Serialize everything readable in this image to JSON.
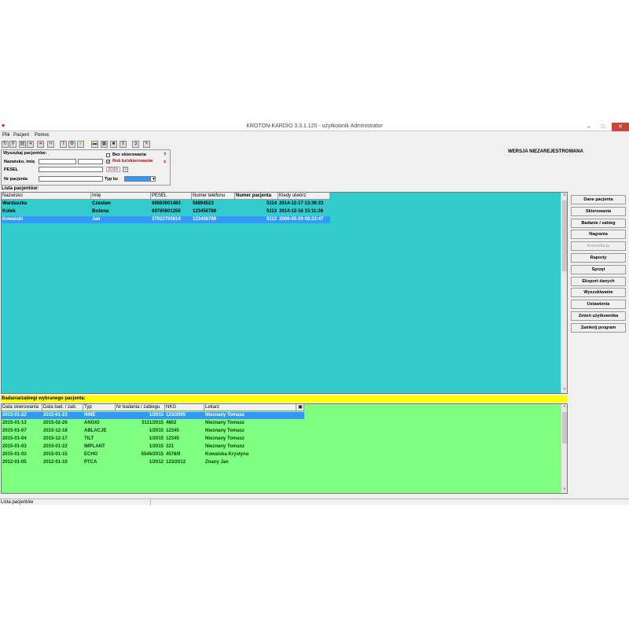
{
  "window": {
    "title": "KROTON-KARDIO 3.3.1.120 - użytkownik Administrator"
  },
  "menu": [
    "Plik",
    "Pacjent",
    "Pomoc"
  ],
  "version_label": "WERSJA NIEZAREJESTROWANA",
  "search": {
    "title": "Wyszukaj pacjentów:",
    "surname_label": "Nazwisko, imię",
    "pesel_label": "PESEL",
    "patient_no_label": "Nr pacjenta",
    "no_referral_label": "Bez skierowania",
    "no_referral_checked": false,
    "year_label": "Rok bz/skierowania",
    "year_checked": true,
    "year_value": "2015",
    "type_label": "Typ bz",
    "help": "?",
    "clear": "x"
  },
  "patients": {
    "title": "Lista pacjentów:",
    "columns": [
      "Nazwisko",
      "Imię",
      "PESEL",
      "Numer telefonu",
      "Numer pacjenta",
      "Kiedy utwórz"
    ],
    "rows": [
      [
        "Wardaszka",
        "Czesław",
        "86083001483",
        "56894523",
        "5114",
        "2014-12-17 13:36:23"
      ],
      [
        "Kotek",
        "Bożena",
        "89785601256",
        "123456789",
        "5113",
        "2014-12-16 15:11:26"
      ],
      [
        "Kowalski",
        "Jan",
        "37022700614",
        "123456789",
        "5112",
        "2006-05-29 08:22:47"
      ]
    ],
    "selected_row": 2
  },
  "buttons": [
    {
      "label": "Dane pacjenta",
      "enabled": true
    },
    {
      "label": "Skierowania",
      "enabled": true
    },
    {
      "label": "Badanie / zabieg",
      "enabled": true
    },
    {
      "label": "Nagrania",
      "enabled": true
    },
    {
      "label": "Konsultacja",
      "enabled": false
    },
    {
      "label": "Raporty",
      "enabled": true
    },
    {
      "label": "Sprzęt",
      "enabled": true
    },
    {
      "label": "Eksport danych",
      "enabled": true
    },
    {
      "label": "Wyszukiwanie",
      "enabled": true
    },
    {
      "label": "Ustawienia",
      "enabled": true
    },
    {
      "label": "Zmień użytkownika",
      "enabled": true
    },
    {
      "label": "Zamknij program",
      "enabled": true
    }
  ],
  "exams": {
    "title": "Badania/zabiegi wybranego pacjenta:",
    "columns": [
      "Data skierowania",
      "Data bad. / zab.",
      "Typ",
      "Nr badania / zabiegu",
      "NKG",
      "Lekarz"
    ],
    "rows": [
      [
        "2015-01-22",
        "2015-01-23",
        "INNE",
        "1/2015",
        "123/2005",
        "Nieznany Tomasz"
      ],
      [
        "2015-01-13",
        "2015-02-26",
        "ANGIO",
        "5111/2015",
        "4802",
        "Nieznany Tomasz"
      ],
      [
        "2015-01-07",
        "2015-12-18",
        "ABLACJE",
        "1/2015",
        "12345",
        "Nieznany Tomasz"
      ],
      [
        "2015-01-04",
        "2015-12-17",
        "TILT",
        "1/2015",
        "12345",
        "Nieznany Tomasz"
      ],
      [
        "2015-01-03",
        "2015-01-22",
        "IMPLANT",
        "1/2015",
        "321",
        "Nieznany Tomasz"
      ],
      [
        "2015-01-02",
        "2015-01-15",
        "ECHO",
        "5546/2015",
        "4578/9",
        "Kowalska Krystyna"
      ],
      [
        "2012-01-05",
        "2012-01-10",
        "PTCA",
        "1/2012",
        "123/2012",
        "Znany Jan"
      ]
    ],
    "selected_row": 0
  },
  "status": "Lista pacjentów"
}
